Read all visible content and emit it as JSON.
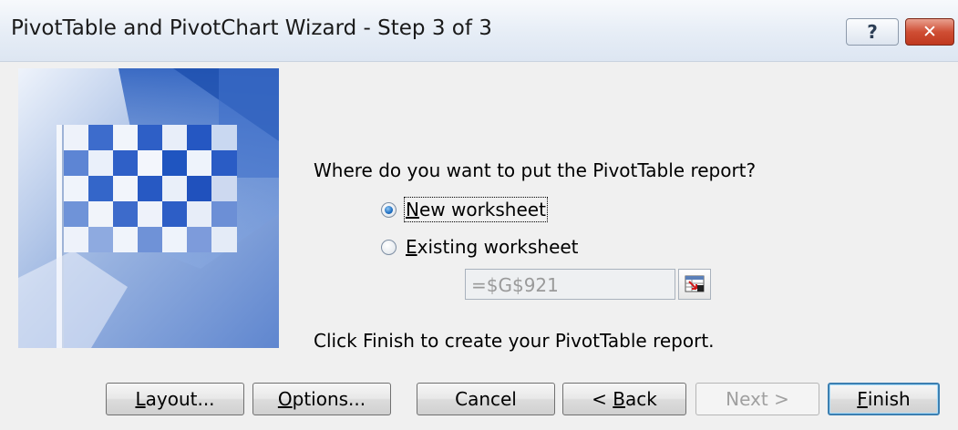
{
  "window": {
    "title": "PivotTable and PivotChart Wizard - Step 3 of 3",
    "help_glyph": "?",
    "close_glyph": "✕"
  },
  "question": "Where do you want to put the PivotTable report?",
  "options": [
    {
      "label": "New worksheet",
      "mnemonic": "N",
      "rest": "ew worksheet",
      "checked": true
    },
    {
      "label": "Existing worksheet",
      "mnemonic": "E",
      "rest": "xisting worksheet",
      "checked": false
    }
  ],
  "reference": {
    "value": "=$G$921",
    "enabled": false
  },
  "hint": "Click Finish to create your PivotTable report.",
  "buttons": {
    "layout": {
      "label": "Layout...",
      "mnemonic": "L",
      "rest": "ayout..."
    },
    "options": {
      "label": "Options...",
      "mnemonic": "O",
      "rest": "ptions..."
    },
    "cancel": {
      "label": "Cancel"
    },
    "back": {
      "label": "< Back",
      "prefix": "< ",
      "mnemonic": "B",
      "rest": "ack"
    },
    "next": {
      "label": "Next >",
      "enabled": false
    },
    "finish": {
      "label": "Finish",
      "mnemonic": "F",
      "rest": "inish",
      "default": true
    }
  },
  "icons": {
    "art": "checkered-flag-icon",
    "ref_collapse": "collapse-dialog-icon"
  },
  "colors": {
    "flag_dark": "#1f5fbf",
    "flag_light": "#e9effa",
    "close_red": "#c0391f",
    "default_button_border": "#3c7fb1"
  }
}
